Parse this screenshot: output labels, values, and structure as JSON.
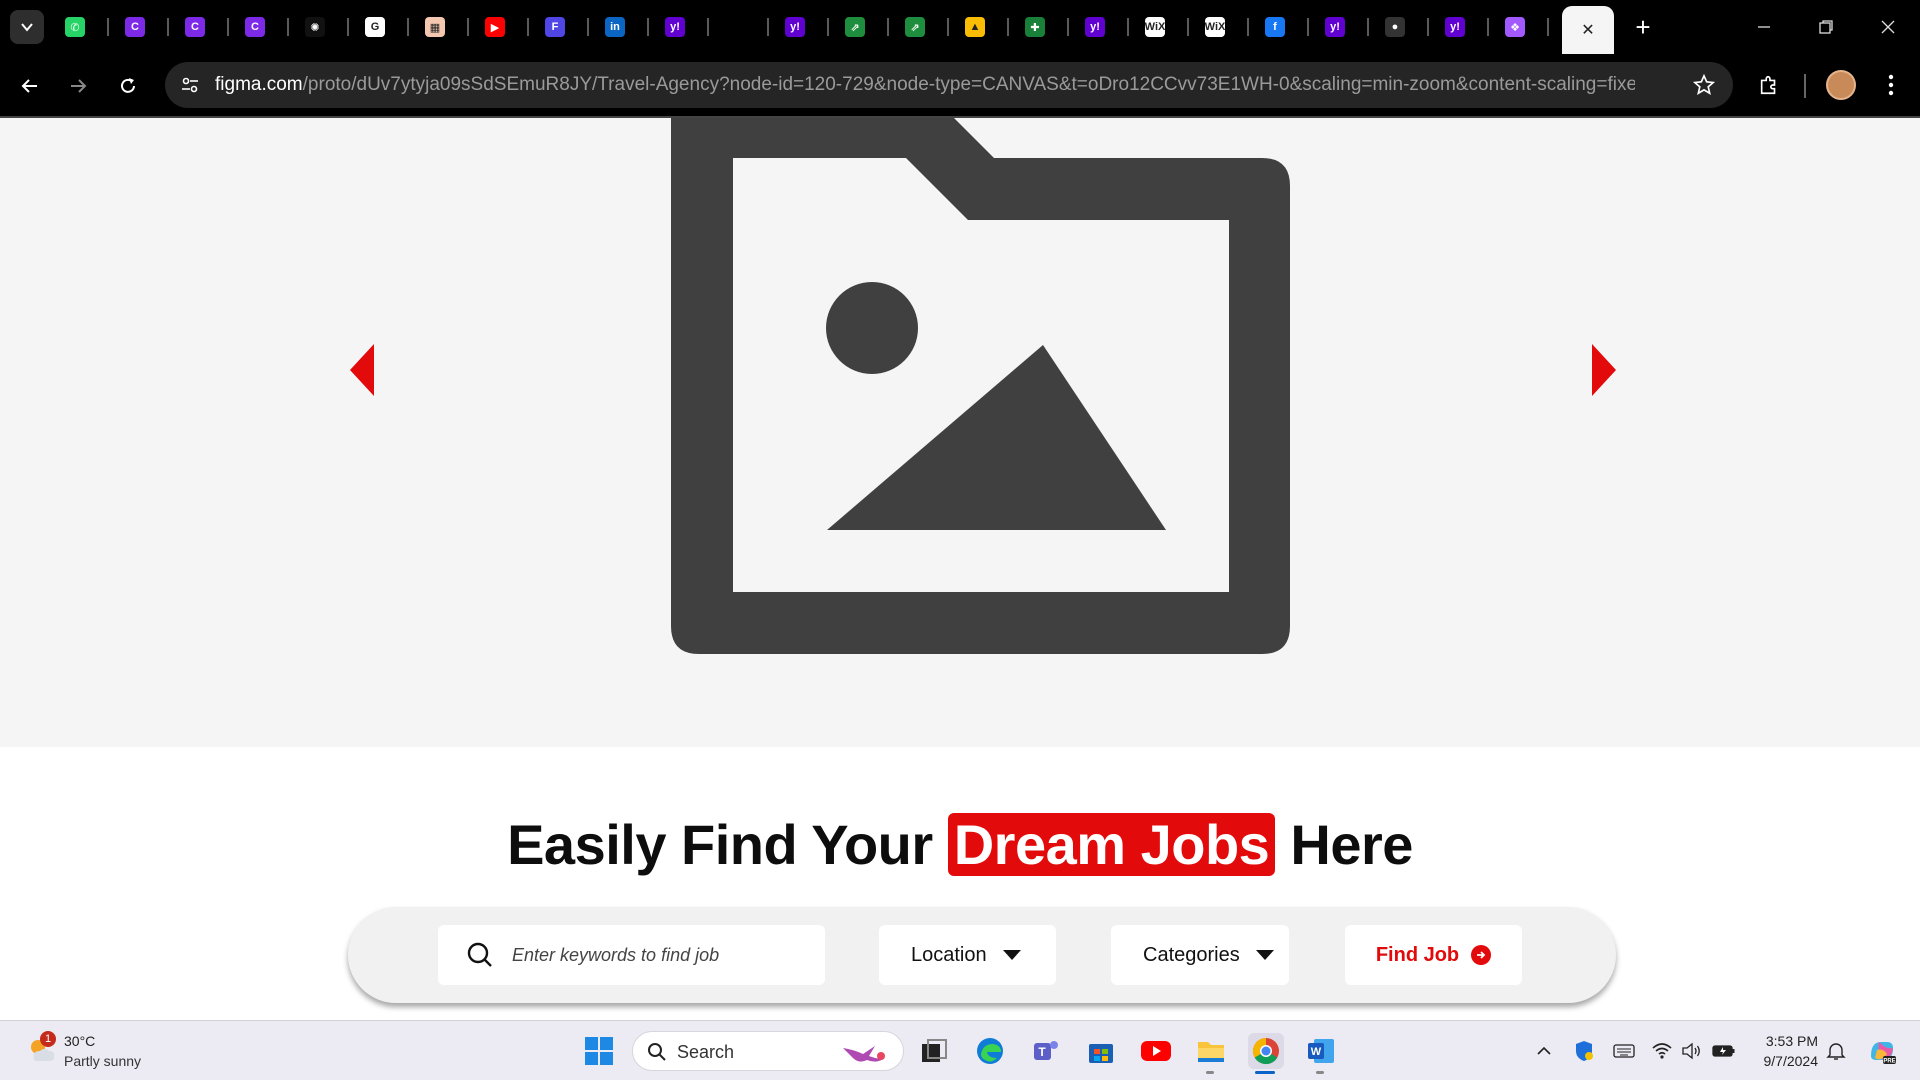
{
  "browser": {
    "tabs": [
      {
        "name": "whatsapp",
        "color": "#25d366",
        "glyph": "✆"
      },
      {
        "name": "canva-1",
        "color": "#7d2ae8",
        "glyph": "C"
      },
      {
        "name": "canva-2",
        "color": "#7d2ae8",
        "glyph": "C"
      },
      {
        "name": "canva-3",
        "color": "#7d2ae8",
        "glyph": "C"
      },
      {
        "name": "chatgpt",
        "color": "#111111",
        "glyph": "✺"
      },
      {
        "name": "google",
        "color": "#ffffff",
        "glyph": "G"
      },
      {
        "name": "photo",
        "color": "#f4c7b1",
        "glyph": "▦"
      },
      {
        "name": "youtube",
        "color": "#ff0000",
        "glyph": "▶"
      },
      {
        "name": "forms",
        "color": "#4f46e5",
        "glyph": "F"
      },
      {
        "name": "linkedin",
        "color": "#0a66c2",
        "glyph": "in"
      },
      {
        "name": "yahoo-1",
        "color": "#6001d2",
        "glyph": "y!"
      },
      {
        "name": "blank",
        "color": "#000000",
        "glyph": ""
      },
      {
        "name": "yahoo-2",
        "color": "#6001d2",
        "glyph": "y!"
      },
      {
        "name": "sheets-link-1",
        "color": "#1e8e3e",
        "glyph": "⇗"
      },
      {
        "name": "sheets-link-2",
        "color": "#1e8e3e",
        "glyph": "⇗"
      },
      {
        "name": "drive",
        "color": "#fbbc04",
        "glyph": "▲"
      },
      {
        "name": "sheets",
        "color": "#188038",
        "glyph": "✚"
      },
      {
        "name": "yahoo-3",
        "color": "#6001d2",
        "glyph": "y!"
      },
      {
        "name": "wix-1",
        "color": "#ffffff",
        "glyph": "WiX"
      },
      {
        "name": "wix-2",
        "color": "#ffffff",
        "glyph": "WiX"
      },
      {
        "name": "facebook",
        "color": "#1877f2",
        "glyph": "f"
      },
      {
        "name": "yahoo-4",
        "color": "#6001d2",
        "glyph": "y!"
      },
      {
        "name": "github",
        "color": "#333333",
        "glyph": "●"
      },
      {
        "name": "yahoo-5",
        "color": "#6001d2",
        "glyph": "y!"
      },
      {
        "name": "figma",
        "color": "#a259ff",
        "glyph": "❖"
      }
    ],
    "url_host": "figma.com",
    "url_path": "/proto/dUv7ytyja09sSdSEmuR8JY/Travel-Agency?node-id=120-729&node-type=CANVAS&t=oDro12CCvv73E1WH-0&scaling=min-zoom&content-scaling=fixed...",
    "close_tab_glyph": "✕",
    "new_tab_glyph": "+"
  },
  "page": {
    "accent": "#e20a0a",
    "headline_pre": "Easily Find Your ",
    "headline_highlight": "Dream Jobs",
    "headline_post": " Here",
    "search_placeholder": "Enter keywords to find job",
    "location_label": "Location",
    "categories_label": "Categories",
    "find_button": "Find Job"
  },
  "taskbar": {
    "weather_badge": "1",
    "temperature": "30°C",
    "condition": "Partly sunny",
    "search_label": "Search",
    "time": "3:53 PM",
    "date": "9/7/2024"
  }
}
